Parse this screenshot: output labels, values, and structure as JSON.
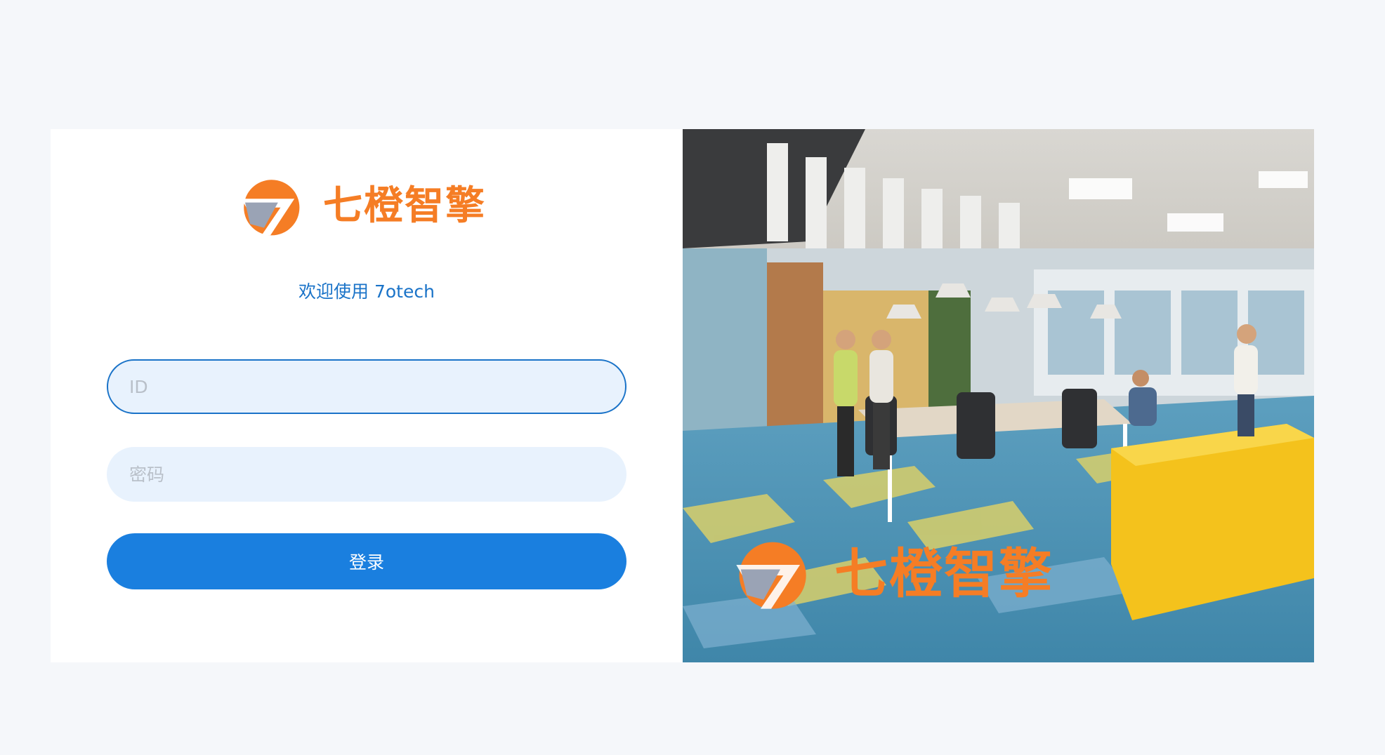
{
  "brand": {
    "name": "七橙智擎",
    "color": "#f57d25",
    "secondary_color": "#9aa3b5"
  },
  "welcome_text": "欢迎使用 7otech",
  "form": {
    "id_placeholder": "ID",
    "id_value": "",
    "password_placeholder": "密码",
    "password_value": "",
    "login_label": "登录"
  },
  "colors": {
    "accent": "#1a7fdf",
    "input_bg": "#e8f2fd",
    "page_bg": "#f5f7fa"
  },
  "hero_image": {
    "icon": "office-photo",
    "watermark_text": "七橙智擎"
  }
}
